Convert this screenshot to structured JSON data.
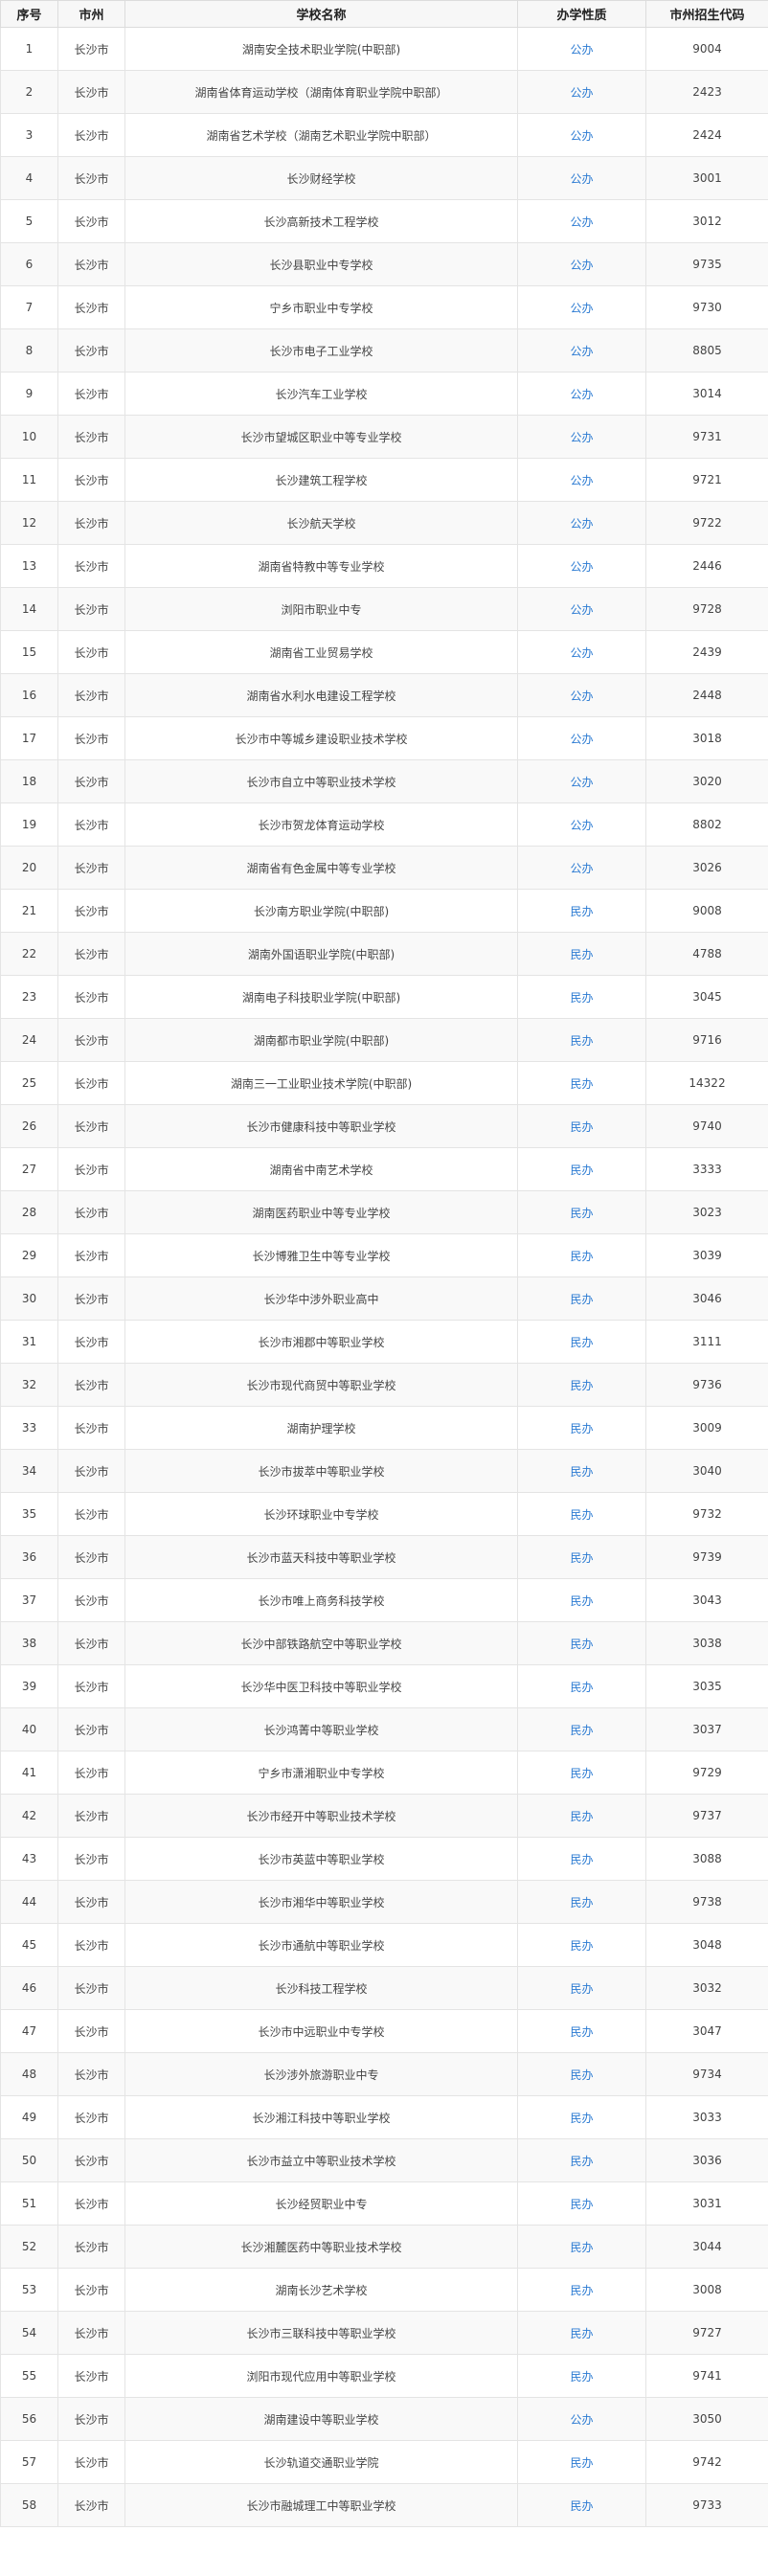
{
  "table": {
    "headers": [
      "序号",
      "市州",
      "学校名称",
      "办学性质",
      "市州招生代码"
    ],
    "rows": [
      [
        "1",
        "长沙市",
        "湖南安全技术职业学院(中职部)",
        "公办",
        "9004"
      ],
      [
        "2",
        "长沙市",
        "湖南省体育运动学校（湖南体育职业学院中职部）",
        "公办",
        "2423"
      ],
      [
        "3",
        "长沙市",
        "湖南省艺术学校（湖南艺术职业学院中职部）",
        "公办",
        "2424"
      ],
      [
        "4",
        "长沙市",
        "长沙财经学校",
        "公办",
        "3001"
      ],
      [
        "5",
        "长沙市",
        "长沙高新技术工程学校",
        "公办",
        "3012"
      ],
      [
        "6",
        "长沙市",
        "长沙县职业中专学校",
        "公办",
        "9735"
      ],
      [
        "7",
        "长沙市",
        "宁乡市职业中专学校",
        "公办",
        "9730"
      ],
      [
        "8",
        "长沙市",
        "长沙市电子工业学校",
        "公办",
        "8805"
      ],
      [
        "9",
        "长沙市",
        "长沙汽车工业学校",
        "公办",
        "3014"
      ],
      [
        "10",
        "长沙市",
        "长沙市望城区职业中等专业学校",
        "公办",
        "9731"
      ],
      [
        "11",
        "长沙市",
        "长沙建筑工程学校",
        "公办",
        "9721"
      ],
      [
        "12",
        "长沙市",
        "长沙航天学校",
        "公办",
        "9722"
      ],
      [
        "13",
        "长沙市",
        "湖南省特教中等专业学校",
        "公办",
        "2446"
      ],
      [
        "14",
        "长沙市",
        "浏阳市职业中专",
        "公办",
        "9728"
      ],
      [
        "15",
        "长沙市",
        "湖南省工业贸易学校",
        "公办",
        "2439"
      ],
      [
        "16",
        "长沙市",
        "湖南省水利水电建设工程学校",
        "公办",
        "2448"
      ],
      [
        "17",
        "长沙市",
        "长沙市中等城乡建设职业技术学校",
        "公办",
        "3018"
      ],
      [
        "18",
        "长沙市",
        "长沙市自立中等职业技术学校",
        "公办",
        "3020"
      ],
      [
        "19",
        "长沙市",
        "长沙市贺龙体育运动学校",
        "公办",
        "8802"
      ],
      [
        "20",
        "长沙市",
        "湖南省有色金属中等专业学校",
        "公办",
        "3026"
      ],
      [
        "21",
        "长沙市",
        "长沙南方职业学院(中职部)",
        "民办",
        "9008"
      ],
      [
        "22",
        "长沙市",
        "湖南外国语职业学院(中职部)",
        "民办",
        "4788"
      ],
      [
        "23",
        "长沙市",
        "湖南电子科技职业学院(中职部)",
        "民办",
        "3045"
      ],
      [
        "24",
        "长沙市",
        "湖南都市职业学院(中职部)",
        "民办",
        "9716"
      ],
      [
        "25",
        "长沙市",
        "湖南三一工业职业技术学院(中职部)",
        "民办",
        "14322"
      ],
      [
        "26",
        "长沙市",
        "长沙市健康科技中等职业学校",
        "民办",
        "9740"
      ],
      [
        "27",
        "长沙市",
        "湖南省中南艺术学校",
        "民办",
        "3333"
      ],
      [
        "28",
        "长沙市",
        "湖南医药职业中等专业学校",
        "民办",
        "3023"
      ],
      [
        "29",
        "长沙市",
        "长沙博雅卫生中等专业学校",
        "民办",
        "3039"
      ],
      [
        "30",
        "长沙市",
        "长沙华中涉外职业高中",
        "民办",
        "3046"
      ],
      [
        "31",
        "长沙市",
        "长沙市湘郡中等职业学校",
        "民办",
        "3111"
      ],
      [
        "32",
        "长沙市",
        "长沙市现代商贸中等职业学校",
        "民办",
        "9736"
      ],
      [
        "33",
        "长沙市",
        "湖南护理学校",
        "民办",
        "3009"
      ],
      [
        "34",
        "长沙市",
        "长沙市拔萃中等职业学校",
        "民办",
        "3040"
      ],
      [
        "35",
        "长沙市",
        "长沙环球职业中专学校",
        "民办",
        "9732"
      ],
      [
        "36",
        "长沙市",
        "长沙市蓝天科技中等职业学校",
        "民办",
        "9739"
      ],
      [
        "37",
        "长沙市",
        "长沙市唯上商务科技学校",
        "民办",
        "3043"
      ],
      [
        "38",
        "长沙市",
        "长沙中部铁路航空中等职业学校",
        "民办",
        "3038"
      ],
      [
        "39",
        "长沙市",
        "长沙华中医卫科技中等职业学校",
        "民办",
        "3035"
      ],
      [
        "40",
        "长沙市",
        "长沙鸿菁中等职业学校",
        "民办",
        "3037"
      ],
      [
        "41",
        "长沙市",
        "宁乡市潇湘职业中专学校",
        "民办",
        "9729"
      ],
      [
        "42",
        "长沙市",
        "长沙市经开中等职业技术学校",
        "民办",
        "9737"
      ],
      [
        "43",
        "长沙市",
        "长沙市英蓝中等职业学校",
        "民办",
        "3088"
      ],
      [
        "44",
        "长沙市",
        "长沙市湘华中等职业学校",
        "民办",
        "9738"
      ],
      [
        "45",
        "长沙市",
        "长沙市通航中等职业学校",
        "民办",
        "3048"
      ],
      [
        "46",
        "长沙市",
        "长沙科技工程学校",
        "民办",
        "3032"
      ],
      [
        "47",
        "长沙市",
        "长沙市中远职业中专学校",
        "民办",
        "3047"
      ],
      [
        "48",
        "长沙市",
        "长沙涉外旅游职业中专",
        "民办",
        "9734"
      ],
      [
        "49",
        "长沙市",
        "长沙湘江科技中等职业学校",
        "民办",
        "3033"
      ],
      [
        "50",
        "长沙市",
        "长沙市益立中等职业技术学校",
        "民办",
        "3036"
      ],
      [
        "51",
        "长沙市",
        "长沙经贸职业中专",
        "民办",
        "3031"
      ],
      [
        "52",
        "长沙市",
        "长沙湘麓医药中等职业技术学校",
        "民办",
        "3044"
      ],
      [
        "53",
        "长沙市",
        "湖南长沙艺术学校",
        "民办",
        "3008"
      ],
      [
        "54",
        "长沙市",
        "长沙市三联科技中等职业学校",
        "民办",
        "9727"
      ],
      [
        "55",
        "长沙市",
        "浏阳市现代应用中等职业学校",
        "民办",
        "9741"
      ],
      [
        "56",
        "长沙市",
        "湖南建设中等职业学校",
        "公办",
        "3050"
      ],
      [
        "57",
        "长沙市",
        "长沙轨道交通职业学院",
        "民办",
        "9742"
      ],
      [
        "58",
        "长沙市",
        "长沙市融城理工中等职业学校",
        "民办",
        "9733"
      ]
    ]
  },
  "colors": {
    "type_link": "#2a7ad2",
    "header_bg": "#f7f7f7",
    "border": "#dcdcdc"
  }
}
